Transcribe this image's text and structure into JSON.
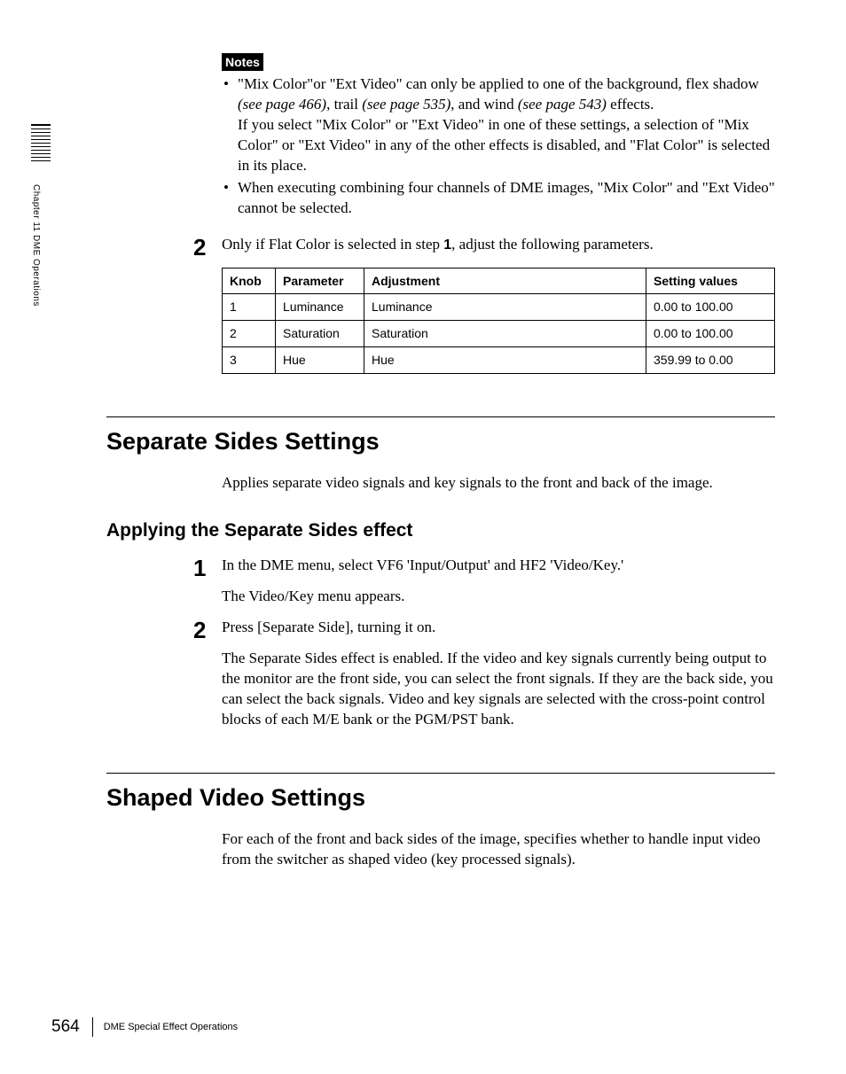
{
  "sidebar": {
    "chapter": "Chapter 11  DME Operations"
  },
  "notes": {
    "label": "Notes",
    "items": [
      {
        "pre": "\"Mix Color\"or \"Ext Video\" can only be applied to one of the background, flex shadow ",
        "ref1": "(see page 466)",
        "mid1": ", trail ",
        "ref2": "(see page 535)",
        "mid2": ", and wind ",
        "ref3": "(see page 543)",
        "tail": " effects.",
        "cont": "If you select \"Mix Color\" or \"Ext Video\" in one of these settings, a selection of \"Mix Color\" or \"Ext Video\" in any of the other effects is disabled, and \"Flat Color\" is selected in its place."
      },
      {
        "pre": "When executing combining four channels of DME images, \"Mix Color\" and \"Ext Video\" cannot be selected.",
        "ref1": "",
        "mid1": "",
        "ref2": "",
        "mid2": "",
        "ref3": "",
        "tail": "",
        "cont": ""
      }
    ]
  },
  "step2": {
    "num": "2",
    "pre": "Only if Flat Color is selected in step ",
    "bold": "1",
    "post": ", adjust the following parameters."
  },
  "table": {
    "headers": {
      "c1": "Knob",
      "c2": "Parameter",
      "c3": "Adjustment",
      "c4": "Setting values"
    },
    "rows": [
      {
        "c1": "1",
        "c2": "Luminance",
        "c3": "Luminance",
        "c4": "0.00 to 100.00"
      },
      {
        "c1": "2",
        "c2": "Saturation",
        "c3": "Saturation",
        "c4": "0.00 to 100.00"
      },
      {
        "c1": "3",
        "c2": "Hue",
        "c3": "Hue",
        "c4": "359.99 to 0.00"
      }
    ]
  },
  "separate": {
    "h1": "Separate Sides Settings",
    "intro": "Applies separate video signals and key signals to the front and back of the image.",
    "h2": "Applying the Separate Sides effect",
    "steps": [
      {
        "num": "1",
        "text": "In the DME menu, select VF6 'Input/Output' and HF2 'Video/Key.'",
        "after": "The Video/Key menu appears."
      },
      {
        "num": "2",
        "text": "Press [Separate Side], turning it on.",
        "after": "The Separate Sides effect is enabled. If the video and key signals currently being output to the monitor are the front side, you can select the front signals. If they are the back side, you can select the back signals. Video and key signals are selected with the cross-point control blocks of each M/E bank or the PGM/PST bank."
      }
    ]
  },
  "shaped": {
    "h1": "Shaped Video Settings",
    "intro": "For each of the front and back sides of the image, specifies whether to handle input video from the switcher as shaped video (key processed signals)."
  },
  "footer": {
    "page": "564",
    "text": "DME Special Effect Operations"
  }
}
